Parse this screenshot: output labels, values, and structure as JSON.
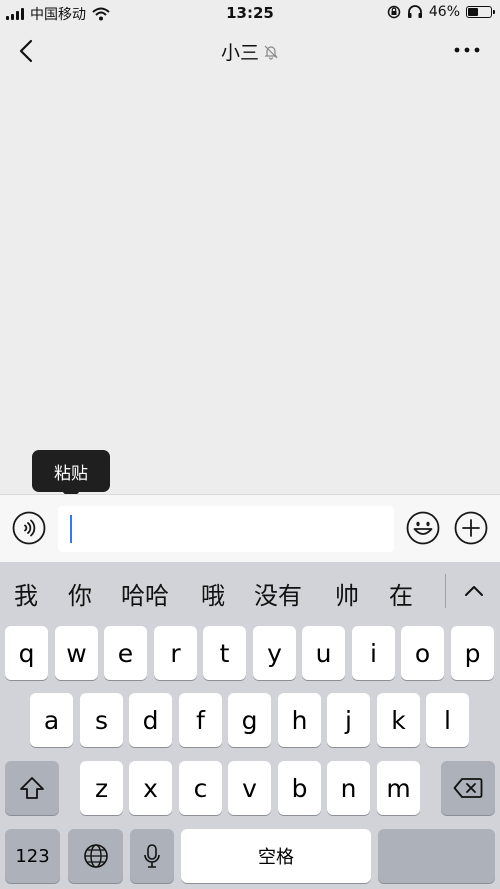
{
  "status": {
    "carrier": "中国移动",
    "time": "13:25",
    "battery": "46%",
    "battery_level": 0.46
  },
  "nav": {
    "title": "小三"
  },
  "tooltip": {
    "paste": "粘贴"
  },
  "input": {
    "value": "",
    "placeholder": ""
  },
  "keyboard": {
    "candidates": [
      "我",
      "你",
      "哈哈",
      "哦",
      "没有",
      "帅",
      "在"
    ],
    "row1": [
      "q",
      "w",
      "e",
      "r",
      "t",
      "y",
      "u",
      "i",
      "o",
      "p"
    ],
    "row2": [
      "a",
      "s",
      "d",
      "f",
      "g",
      "h",
      "j",
      "k",
      "l"
    ],
    "row3": [
      "z",
      "x",
      "c",
      "v",
      "b",
      "n",
      "m"
    ],
    "numbers_label": "123",
    "space_label": "空格"
  },
  "icons": {
    "back": "chevron-left-icon",
    "mute": "bell-slash-icon",
    "more": "more-icon",
    "voice": "voice-icon",
    "emoji": "emoji-icon",
    "plus": "plus-icon",
    "shift": "shift-icon",
    "delete": "backspace-icon",
    "globe": "globe-icon",
    "mic": "microphone-icon"
  }
}
